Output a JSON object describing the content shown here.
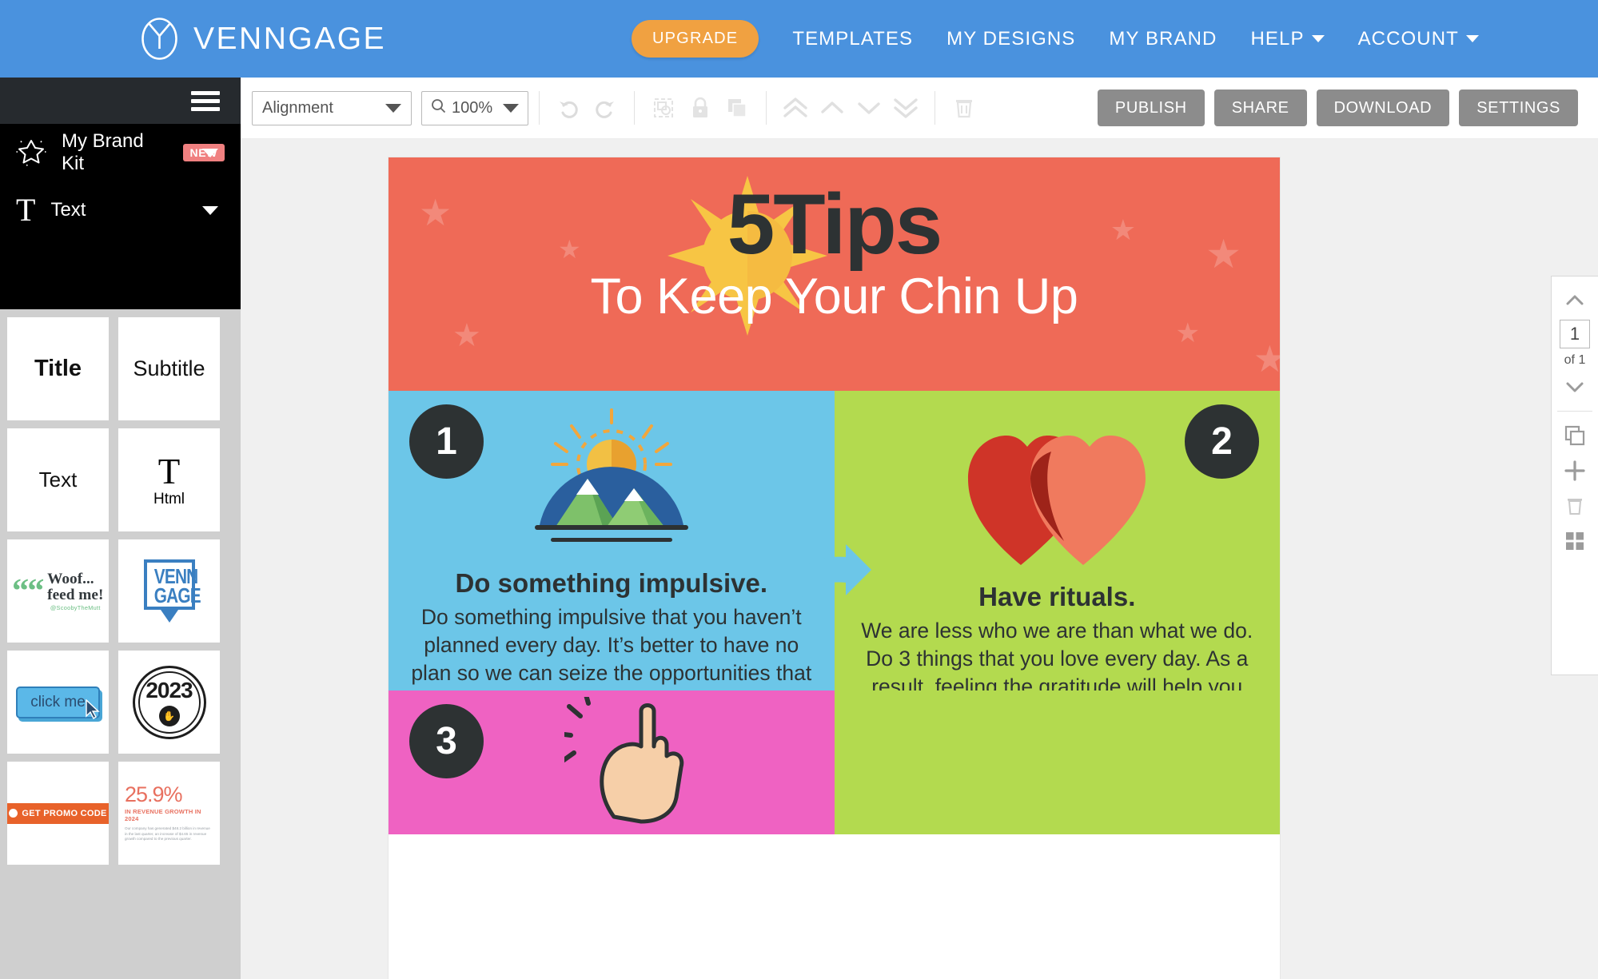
{
  "app": {
    "brand_name": "VENNGAGE",
    "brand_icon": "venngage-logo-icon"
  },
  "topnav": {
    "upgrade_label": "UPGRADE",
    "links": [
      {
        "label": "TEMPLATES",
        "has_caret": false
      },
      {
        "label": "MY DESIGNS",
        "has_caret": false
      },
      {
        "label": "MY BRAND",
        "has_caret": false
      },
      {
        "label": "HELP",
        "has_caret": true
      },
      {
        "label": "ACCOUNT",
        "has_caret": true
      }
    ]
  },
  "sidebar": {
    "brand_kit": {
      "label": "My Brand Kit",
      "badge": "NEW",
      "icon": "star-icon"
    },
    "text_section": {
      "label": "Text",
      "icon": "text-t-icon"
    },
    "tiles": [
      {
        "kind": "title",
        "label": "Title"
      },
      {
        "kind": "subtitle",
        "label": "Subtitle"
      },
      {
        "kind": "text",
        "label": "Text"
      },
      {
        "kind": "html",
        "label": "Html",
        "glyph": "T"
      },
      {
        "kind": "quote",
        "line1": "Woof...",
        "line2": "feed me!",
        "handle": "@ScoobyTheMutt"
      },
      {
        "kind": "venngage_box",
        "line1": "VENN",
        "line2": "GAGE"
      },
      {
        "kind": "button",
        "label": "click me"
      },
      {
        "kind": "badge_year",
        "year": "2023"
      },
      {
        "kind": "promo",
        "label": "GET PROMO CODE"
      },
      {
        "kind": "stat",
        "number": "25.9%",
        "subtitle": "IN REVENUE GROWTH IN 2024",
        "body": "Our company has generated $48.2 billion in revenue in the last quarter, an increase of $4.65 in revenue growth compared to the previous quarter."
      }
    ]
  },
  "toolbar": {
    "alignment_label": "Alignment",
    "zoom_value": "100%",
    "icons": [
      {
        "name": "undo-icon",
        "title": "Undo"
      },
      {
        "name": "redo-icon",
        "title": "Redo"
      },
      {
        "name": "group-icon",
        "title": "Group"
      },
      {
        "name": "lock-icon",
        "title": "Lock"
      },
      {
        "name": "duplicate-icon",
        "title": "Duplicate"
      },
      {
        "name": "bring-to-front-icon",
        "title": "Bring to front"
      },
      {
        "name": "bring-forward-icon",
        "title": "Bring forward"
      },
      {
        "name": "send-backward-icon",
        "title": "Send backward"
      },
      {
        "name": "send-to-back-icon",
        "title": "Send to back"
      },
      {
        "name": "trash-icon",
        "title": "Delete"
      }
    ],
    "actions": [
      "PUBLISH",
      "SHARE",
      "DOWNLOAD",
      "SETTINGS"
    ]
  },
  "canvas": {
    "hero": {
      "title_number": "5",
      "title_word": "Tips",
      "subtitle": "To Keep Your Chin Up",
      "bg_color": "#ef6a57"
    },
    "tips": [
      {
        "number": "1",
        "heading": "Do something impulsive.",
        "body": "Do something impulsive that you haven’t planned every day. It’s better to have no plan so we can seize the opportunities that may arise.",
        "bg_color": "#6cc6e8",
        "icon": "mountain-sun-icon"
      },
      {
        "number": "2",
        "heading": "Have rituals.",
        "body": "We are less who we are than what we do. Do 3 things that you love every day. As a result, feeling the gratitude will help you better sleep. Better sleep helps to be in a better mood. A better mood helps to",
        "bg_color": "#b3da4f",
        "icon": "hearts-icon"
      },
      {
        "number": "3",
        "bg_color": "#ef62c2",
        "icon": "snap-fingers-icon"
      }
    ]
  },
  "rightpanel": {
    "page_current": "1",
    "page_total_label": "of 1",
    "buttons": [
      {
        "name": "scroll-up-button",
        "icon": "chevron-up-icon"
      },
      {
        "name": "scroll-down-button",
        "icon": "chevron-down-icon"
      },
      {
        "name": "duplicate-page-button",
        "icon": "copy-icon"
      },
      {
        "name": "add-page-button",
        "icon": "plus-icon"
      },
      {
        "name": "delete-page-button",
        "icon": "trash-icon"
      },
      {
        "name": "grid-view-button",
        "icon": "grid-icon"
      }
    ]
  },
  "colors": {
    "brand_blue": "#4a92de",
    "upgrade_orange": "#f0a141",
    "badge_red": "#f08080",
    "hero_red": "#ef6a57",
    "tip_blue": "#6cc6e8",
    "tip_green": "#b3da4f",
    "tip_pink": "#ef62c2",
    "action_gray": "#8c8c8c"
  }
}
